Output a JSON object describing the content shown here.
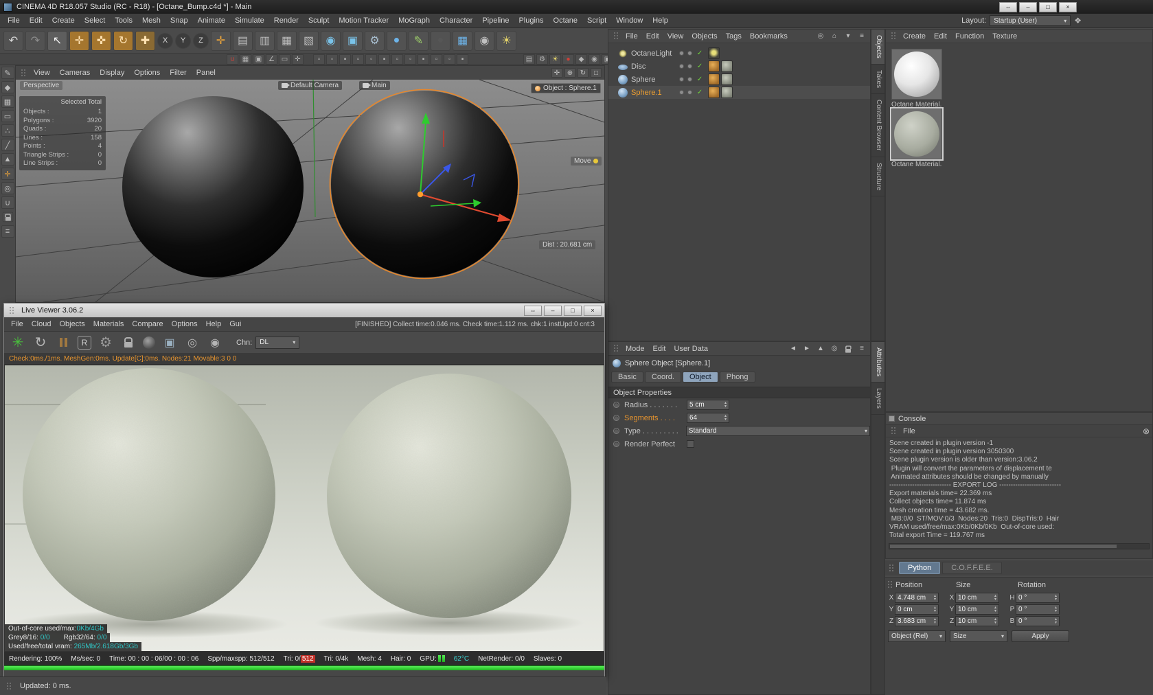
{
  "colors": {
    "accent_orange": "#e8952f",
    "check_green": "#6fd33a",
    "cyan_value": "#2fc6c6",
    "progress_green": "#2ed02e",
    "tab_blue": "#8ea4bc",
    "selection_outline": "#e8872a"
  },
  "ui": {
    "dd_arrow": "▾",
    "step_up": "▴",
    "step_down": "▾",
    "check_glyph": "✓"
  },
  "titlebar": {
    "title": "CINEMA 4D R18.057 Studio (RC - R18) - [Octane_Bump.c4d *] - Main"
  },
  "window_controls": {
    "buttons": [
      {
        "name": "undock-button",
        "glyph": "⇔"
      },
      {
        "name": "minimize-button",
        "glyph": "–"
      },
      {
        "name": "maximize-button",
        "glyph": "□"
      },
      {
        "name": "close-button",
        "glyph": "×"
      }
    ]
  },
  "menubar": {
    "items": [
      "File",
      "Edit",
      "Create",
      "Select",
      "Tools",
      "Mesh",
      "Snap",
      "Animate",
      "Simulate",
      "Render",
      "Sculpt",
      "Motion Tracker",
      "MoGraph",
      "Character",
      "Pipeline",
      "Plugins",
      "Octane",
      "Script",
      "Window",
      "Help"
    ],
    "layout_label": "Layout:",
    "layout_value": "Startup (User)",
    "layout_icon": "❖"
  },
  "toolbar1": {
    "icons": [
      {
        "name": "undo-icon",
        "glyph": "↶",
        "fg": "#d6d6d6"
      },
      {
        "name": "redo-icon",
        "glyph": "↷",
        "fg": "#8c8c8c"
      },
      {
        "name": "live-selection-icon",
        "glyph": "↖",
        "fg": "#f0f0f0",
        "bg": "#5e5e5e"
      },
      {
        "name": "move-tool-icon",
        "glyph": "✛",
        "fg": "#ffe2b2",
        "bg": "#a5762e"
      },
      {
        "name": "scale-tool-icon",
        "glyph": "✜",
        "fg": "#ffe2b2",
        "bg": "#a5762e"
      },
      {
        "name": "rotate-tool-icon",
        "glyph": "↻",
        "fg": "#ffe2b2",
        "bg": "#a5762e"
      },
      {
        "name": "last-tool-icon",
        "glyph": "✚",
        "fg": "#ffe2b2",
        "bg": "#8a6a33"
      },
      {
        "name": "lock-x-icon",
        "glyph": "X",
        "fg": "#d8d8d8",
        "bg": "#3c3c3c",
        "cls": "round"
      },
      {
        "name": "lock-y-icon",
        "glyph": "Y",
        "fg": "#d8d8d8",
        "bg": "#3c3c3c",
        "cls": "round"
      },
      {
        "name": "lock-z-icon",
        "glyph": "Z",
        "fg": "#d8d8d8",
        "bg": "#3c3c3c",
        "cls": "round"
      },
      {
        "name": "coord-system-icon",
        "glyph": "✛",
        "fg": "#e8a23a"
      },
      {
        "name": "modeling-palette-icon",
        "glyph": "▤",
        "fg": "#bcbcbc"
      },
      {
        "name": "snap-palette-icon",
        "glyph": "▥",
        "fg": "#bcbcbc"
      },
      {
        "name": "workplane-palette-icon",
        "glyph": "▦",
        "fg": "#bcbcbc"
      },
      {
        "name": "spline-palette-icon",
        "glyph": "▧",
        "fg": "#bcbcbc"
      },
      {
        "name": "render-view-icon",
        "glyph": "◉",
        "fg": "#79c2e8"
      },
      {
        "name": "render-picture-viewer-icon",
        "glyph": "▣",
        "fg": "#79c2e8"
      },
      {
        "name": "render-settings-icon",
        "glyph": "⚙",
        "fg": "#a8bed0"
      },
      {
        "name": "primitive-cube-icon",
        "glyph": "●",
        "fg": "#6db3e8"
      },
      {
        "name": "spline-pen-icon",
        "glyph": "✎",
        "fg": "#9ed06a"
      },
      {
        "name": "generators-icon",
        "glyph": "●",
        "fg": "#565656"
      },
      {
        "name": "floor-icon",
        "glyph": "▦",
        "fg": "#6db3e8"
      },
      {
        "name": "camera-icon",
        "glyph": "◉",
        "fg": "#c0c0c0"
      },
      {
        "name": "light-icon",
        "glyph": "☀",
        "fg": "#e8d76a"
      }
    ]
  },
  "toolbar2": {
    "group1": [
      {
        "name": "enable-snap-icon",
        "glyph": "∪",
        "fg": "#d04038"
      },
      {
        "name": "snap-3d-icon",
        "glyph": "▦"
      },
      {
        "name": "snap-grid-icon",
        "glyph": "▣"
      },
      {
        "name": "quantize-icon",
        "glyph": "∠"
      },
      {
        "name": "workplane-snap-icon",
        "glyph": "▭"
      },
      {
        "name": "dynamic-guides-icon",
        "glyph": "✛"
      }
    ],
    "group2": [
      {
        "name": "snap-option-icon",
        "glyph": "▫"
      },
      {
        "name": "snap-option-icon",
        "glyph": "◦"
      },
      {
        "name": "snap-option-icon",
        "glyph": "▪"
      },
      {
        "name": "snap-option-icon",
        "glyph": "▫"
      },
      {
        "name": "snap-option-icon",
        "glyph": "◦"
      },
      {
        "name": "snap-option-icon",
        "glyph": "▪"
      },
      {
        "name": "snap-option-icon",
        "glyph": "▫"
      },
      {
        "name": "snap-option-icon",
        "glyph": "◦"
      },
      {
        "name": "snap-option-icon",
        "glyph": "▪"
      },
      {
        "name": "snap-option-icon",
        "glyph": "▫"
      },
      {
        "name": "snap-option-icon",
        "glyph": "◦"
      },
      {
        "name": "snap-option-icon",
        "glyph": "▪"
      }
    ],
    "group3": [
      {
        "name": "viewport-grid-icon",
        "glyph": "▤"
      },
      {
        "name": "viewport-settings-icon",
        "glyph": "⚙"
      },
      {
        "name": "viewport-sun-icon",
        "glyph": "☀",
        "fg": "#e8d76a"
      },
      {
        "name": "record-icon",
        "glyph": "●",
        "fg": "#d04038"
      },
      {
        "name": "keyframe-icon",
        "glyph": "◆"
      },
      {
        "name": "camera-view-icon",
        "glyph": "◉"
      },
      {
        "name": "film-icon",
        "glyph": "▣"
      },
      {
        "name": "viewport-menu-icon",
        "glyph": "≡"
      }
    ]
  },
  "left_toolbar": {
    "icons": [
      {
        "name": "make-editable-icon",
        "glyph": "✎"
      },
      {
        "name": "model-mode-icon",
        "glyph": "◆"
      },
      {
        "name": "texture-mode-icon",
        "glyph": "▦"
      },
      {
        "name": "workplane-mode-icon",
        "glyph": "▭"
      },
      {
        "name": "points-mode-icon",
        "glyph": "∴"
      },
      {
        "name": "edges-mode-icon",
        "glyph": "╱"
      },
      {
        "name": "polygons-mode-icon",
        "glyph": "▲"
      },
      {
        "name": "axis-mode-icon",
        "glyph": "✛",
        "fg": "#e8a23a"
      },
      {
        "name": "viewport-solo-icon",
        "glyph": "◎"
      },
      {
        "name": "snap-mode-icon",
        "glyph": "∪"
      },
      {
        "name": "lock-icon",
        "cls": "icon-lock-sm"
      },
      {
        "name": "tool-menu-icon",
        "glyph": "≡"
      }
    ]
  },
  "viewport": {
    "menu": [
      "View",
      "Cameras",
      "Display",
      "Options",
      "Filter",
      "Panel"
    ],
    "right_icons": [
      {
        "name": "pan-view-icon",
        "glyph": "✛"
      },
      {
        "name": "zoom-view-icon",
        "glyph": "⊕"
      },
      {
        "name": "rotate-view-icon",
        "glyph": "↻"
      },
      {
        "name": "maximize-view-icon",
        "glyph": "□"
      }
    ],
    "hud": {
      "perspective": "Perspective",
      "camera": "Default Camera",
      "main": "Main",
      "object": "Object : Sphere.1",
      "move": "Move",
      "dist": "Dist : 20.681 cm"
    },
    "stats": {
      "header": "Selected Total",
      "rows": [
        {
          "label": "Objects :",
          "value": "1"
        },
        {
          "label": "Polygons :",
          "value": "3920"
        },
        {
          "label": "Quads :",
          "value": "20"
        },
        {
          "label": "Lines :",
          "value": "158"
        },
        {
          "label": "Points :",
          "value": "4"
        },
        {
          "label": "Triangle Strips :",
          "value": "0"
        },
        {
          "label": "Line Strips :",
          "value": "0"
        }
      ]
    }
  },
  "live_viewer": {
    "title": "Live Viewer 3.06.2",
    "menu": [
      "File",
      "Cloud",
      "Objects",
      "Materials",
      "Compare",
      "Options",
      "Help",
      "Gui"
    ],
    "finish_status": "[FINISHED] Collect time:0.046 ms.  Check time:1.112 ms.  chk:1  instUpd:0  cnt:3",
    "toolbar_icons": [
      {
        "name": "octane-render-icon",
        "glyph": "✳",
        "fg": "#49c23c",
        "cls": "lv-big"
      },
      {
        "name": "restart-render-icon",
        "glyph": "↻",
        "fg": "#b5b5b5",
        "cls": "lv-big"
      },
      {
        "name": "pause-render-icon",
        "cls": "icon-pause"
      },
      {
        "name": "reset-icon",
        "glyph": "R",
        "cls": "icon-boxed"
      },
      {
        "name": "settings-gear-icon",
        "glyph": "⚙",
        "fg": "#9a9a9a",
        "cls": "lv-big"
      },
      {
        "name": "lock-resolution-icon",
        "cls": "icon-lock"
      },
      {
        "name": "material-ball-icon",
        "cls": "icon-ball"
      },
      {
        "name": "clay-mode-icon",
        "glyph": "▣",
        "fg": "#9ab0c0"
      },
      {
        "name": "focus-picker-icon",
        "glyph": "◎",
        "fg": "#b5b5b5"
      },
      {
        "name": "material-picker-icon",
        "glyph": "◉",
        "fg": "#b5b5b5"
      }
    ],
    "chn_label": "Chn:",
    "chn_value": "DL",
    "check_line": "Check:0ms./1ms. MeshGen:0ms. Update[C]:0ms. Nodes:21 Movable:3  0 0",
    "overlay_lines": [
      {
        "a": "Out-of-core used/max:",
        "b": "0Kb/4Gb"
      },
      {
        "a": "Grey8/16: ",
        "b": "0/0",
        "c": "Rgb32/64: ",
        "d": "0/0"
      },
      {
        "a": "Used/free/total vram: ",
        "b": "265Mb/2.618Gb/3Gb"
      }
    ],
    "statusbar": {
      "segs1": [
        "Rendering: 100%",
        "Ms/sec: 0",
        "Time: 00 : 00 : 06/00 : 00 : 06",
        "Spp/maxspp: 512/512"
      ],
      "tri_label": "Tri: 0/",
      "tri_value": "512",
      "segs2": [
        "Tri: 0/4k",
        "Mesh: 4",
        "Hair: 0"
      ],
      "gpu_label": "GPU:",
      "temp": "62°C",
      "segs3": [
        "NetRender: 0/0",
        "Slaves: 0"
      ]
    }
  },
  "object_manager": {
    "menu": [
      "File",
      "Edit",
      "View",
      "Objects",
      "Tags",
      "Bookmarks"
    ],
    "header_icons": [
      {
        "name": "search-icon",
        "glyph": "◎"
      },
      {
        "name": "home-icon",
        "glyph": "⌂"
      },
      {
        "name": "filter-icon",
        "glyph": "▾"
      },
      {
        "name": "om-menu-icon",
        "glyph": "≡"
      }
    ],
    "rows": [
      {
        "label": "OctaneLight",
        "cls": "icon-light has-light-tag"
      },
      {
        "label": "Disc",
        "cls": "icon-disc has-mat has-tex"
      },
      {
        "label": "Sphere",
        "cls": "icon-sphere has-mat has-tex"
      },
      {
        "label": "Sphere.1",
        "cls": "icon-sphere selected has-mat has-tex"
      }
    ]
  },
  "side_tabs_top": [
    {
      "label": "Objects",
      "cls": "active"
    },
    {
      "label": "Takes"
    },
    {
      "label": "Content Browser"
    },
    {
      "label": "Structure"
    }
  ],
  "material_manager": {
    "menu": [
      "Create",
      "Edit",
      "Function",
      "Texture"
    ],
    "items": [
      {
        "label": "Octane Material.",
        "cls": "mat-white"
      },
      {
        "label": "Octane Material.",
        "cls": "mat-grey selected"
      }
    ]
  },
  "attribute_manager": {
    "menu": [
      "Mode",
      "Edit",
      "User Data"
    ],
    "header_icons": [
      {
        "name": "back-icon",
        "glyph": "◄"
      },
      {
        "name": "forward-icon",
        "glyph": "►"
      },
      {
        "name": "up-icon",
        "glyph": "▲"
      },
      {
        "name": "search-icon",
        "glyph": "◎"
      },
      {
        "name": "lock-icon",
        "cls": "icon-lock-sm"
      },
      {
        "name": "am-menu-icon",
        "glyph": "≡"
      }
    ],
    "object_title": "Sphere Object [Sphere.1]",
    "tabs": [
      {
        "label": "Basic"
      },
      {
        "label": "Coord."
      },
      {
        "label": "Object",
        "cls": "active"
      },
      {
        "label": "Phong"
      }
    ],
    "section": "Object Properties",
    "radius_label": "Radius . . . . . . .",
    "radius_value": "5 cm",
    "segments_label": "Segments . . . .",
    "segments_value": "64",
    "type_label": "Type . . . . . . . . .",
    "type_value": "Standard",
    "render_perfect_label": "Render Perfect"
  },
  "side_tabs_bottom": [
    {
      "label": "Attributes",
      "cls": "active"
    },
    {
      "label": "Layers"
    }
  ],
  "console": {
    "title": "Console",
    "menu_file": "File",
    "close_glyph": "⊗",
    "lines": [
      "Scene created in plugin version -1",
      "Scene created in plugin version 3050300",
      "Scene plugin version is older than version:3.06.2",
      " Plugin will convert the parameters of displacement te",
      " Animated attributes should be changed by manually",
      "--------------------------- EXPORT LOG ---------------------------",
      "Export materials time= 22.369 ms",
      "Collect objects time= 11.874 ms",
      "Mesh creation time = 43.682 ms.",
      " MB:0/0  ST/MOV:0/3  Nodes:20  Tris:0  DispTris:0  Hair",
      "VRAM used/free/max:0Kb/0Kb/0Kb  Out-of-core used:",
      "Total export Time = 119.767 ms"
    ]
  },
  "script_tabs": [
    {
      "label": "Python",
      "cls": "active"
    },
    {
      "label": "C.O.F.F.E.E."
    }
  ],
  "coordinates": {
    "headers": [
      "Position",
      "Size",
      "Rotation"
    ],
    "rows": [
      {
        "pl": "X",
        "pv": "4.748 cm",
        "sl": "X",
        "sv": "10 cm",
        "rl": "H",
        "rv": "0 °"
      },
      {
        "pl": "Y",
        "pv": "0 cm",
        "sl": "Y",
        "sv": "10 cm",
        "rl": "P",
        "rv": "0 °"
      },
      {
        "pl": "Z",
        "pv": "3.683 cm",
        "sl": "Z",
        "sv": "10 cm",
        "rl": "B",
        "rv": "0 °"
      }
    ],
    "object_mode": "Object (Rel)",
    "size_mode": "Size",
    "apply": "Apply"
  },
  "statusbar": {
    "text": "Updated: 0 ms."
  }
}
